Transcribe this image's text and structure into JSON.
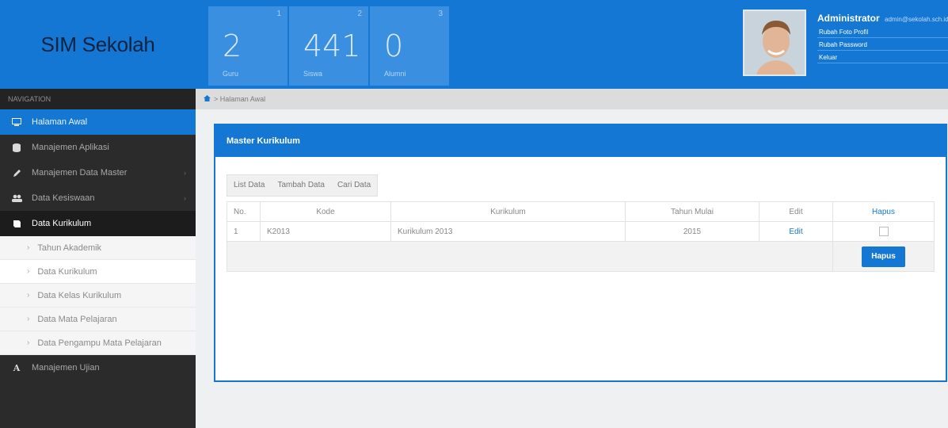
{
  "brand": {
    "title": "SIM Sekolah"
  },
  "stats": [
    {
      "index": "1",
      "value": "2",
      "label": "Guru"
    },
    {
      "index": "2",
      "value": "441",
      "label": "Siswa"
    },
    {
      "index": "3",
      "value": "0",
      "label": "Alumni"
    }
  ],
  "user": {
    "name": "Administrator",
    "email": "admin@sekolah.sch.id",
    "links": [
      "Rubah Foto Profil",
      "Rubah Password",
      "Keluar"
    ]
  },
  "sidebar": {
    "header": "NAVIGATION",
    "items": [
      {
        "label": "Halaman Awal",
        "icon": "monitor-icon"
      },
      {
        "label": "Manajemen Aplikasi",
        "icon": "database-icon"
      },
      {
        "label": "Manajemen Data Master",
        "icon": "pencil-icon"
      },
      {
        "label": "Data Kesiswaan",
        "icon": "users-icon"
      },
      {
        "label": "Data Kurikulum",
        "icon": "book-icon"
      }
    ],
    "subitems": [
      "Tahun Akademik",
      "Data Kurikulum",
      "Data Kelas Kurikulum",
      "Data Mata Pelajaran",
      "Data Pengampu Mata Pelajaran"
    ],
    "last_item": {
      "label": "Manajemen Ujian",
      "icon": "font-icon"
    }
  },
  "breadcrumb": {
    "label": "Halaman Awal"
  },
  "panel": {
    "title": "Master Kurikulum",
    "tabs": [
      "List Data",
      "Tambah Data",
      "Cari Data"
    ],
    "columns": [
      "No.",
      "Kode",
      "Kurikulum",
      "Tahun Mulai",
      "Edit",
      "Hapus"
    ],
    "rows": [
      {
        "no": "1",
        "kode": "K2013",
        "kurikulum": "Kurikulum 2013",
        "tahun": "2015",
        "edit": "Edit"
      }
    ],
    "hapus_button": "Hapus"
  },
  "colors": {
    "primary": "#1577d4",
    "sidebar": "#2b2b2b"
  }
}
